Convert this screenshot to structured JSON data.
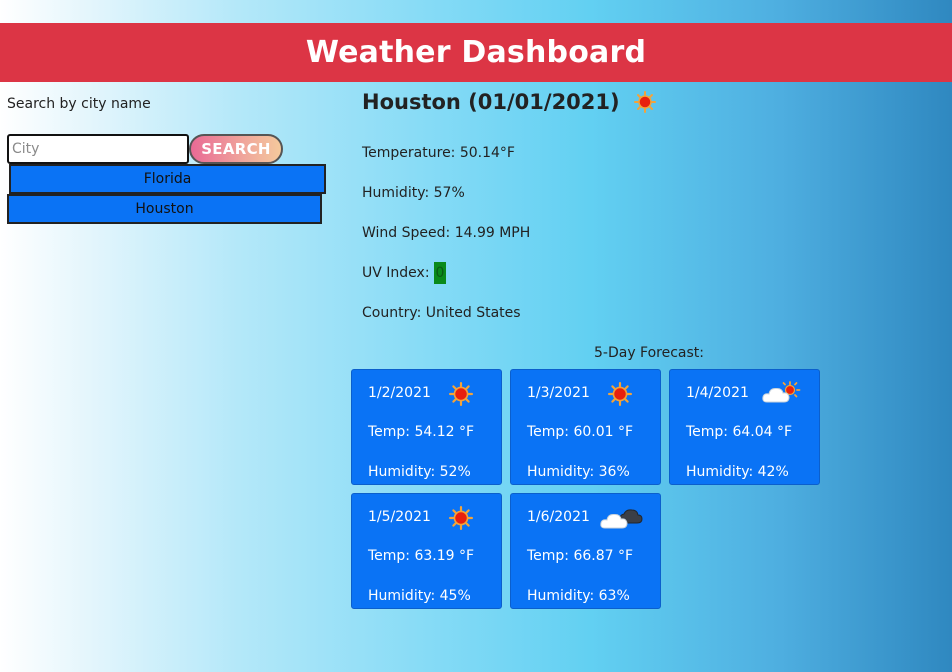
{
  "header": {
    "title": "Weather Dashboard"
  },
  "search": {
    "label": "Search by city name",
    "placeholder": "City",
    "button_label": "SEARCH"
  },
  "history": [
    "Florida",
    "Houston"
  ],
  "current": {
    "title": "Houston (01/01/2021)",
    "icon": "sun-icon",
    "temperature": "Temperature: 50.14°F",
    "humidity": "Humidity: 57%",
    "wind": "Wind Speed: 14.99 MPH",
    "uv_label": "UV Index:",
    "uv_value": "0",
    "country": "Country: United States"
  },
  "forecast": {
    "title": "5-Day Forecast:",
    "days": [
      {
        "date": "1/2/2021",
        "icon": "sun-icon",
        "temp": "Temp: 54.12 °F",
        "humidity": "Humidity: 52%"
      },
      {
        "date": "1/3/2021",
        "icon": "sun-icon",
        "temp": "Temp: 60.01 °F",
        "humidity": "Humidity: 36%"
      },
      {
        "date": "1/4/2021",
        "icon": "sun-behind-cloud-icon",
        "temp": "Temp: 64.04 °F",
        "humidity": "Humidity: 42%"
      },
      {
        "date": "1/5/2021",
        "icon": "sun-icon",
        "temp": "Temp: 63.19 °F",
        "humidity": "Humidity: 45%"
      },
      {
        "date": "1/6/2021",
        "icon": "dark-cloud-icon",
        "temp": "Temp: 66.87 °F",
        "humidity": "Humidity: 63%"
      }
    ]
  },
  "colors": {
    "header_bg": "#dc3545",
    "card_bg": "#0a73f5",
    "uv_badge": "#0a8a1a"
  }
}
